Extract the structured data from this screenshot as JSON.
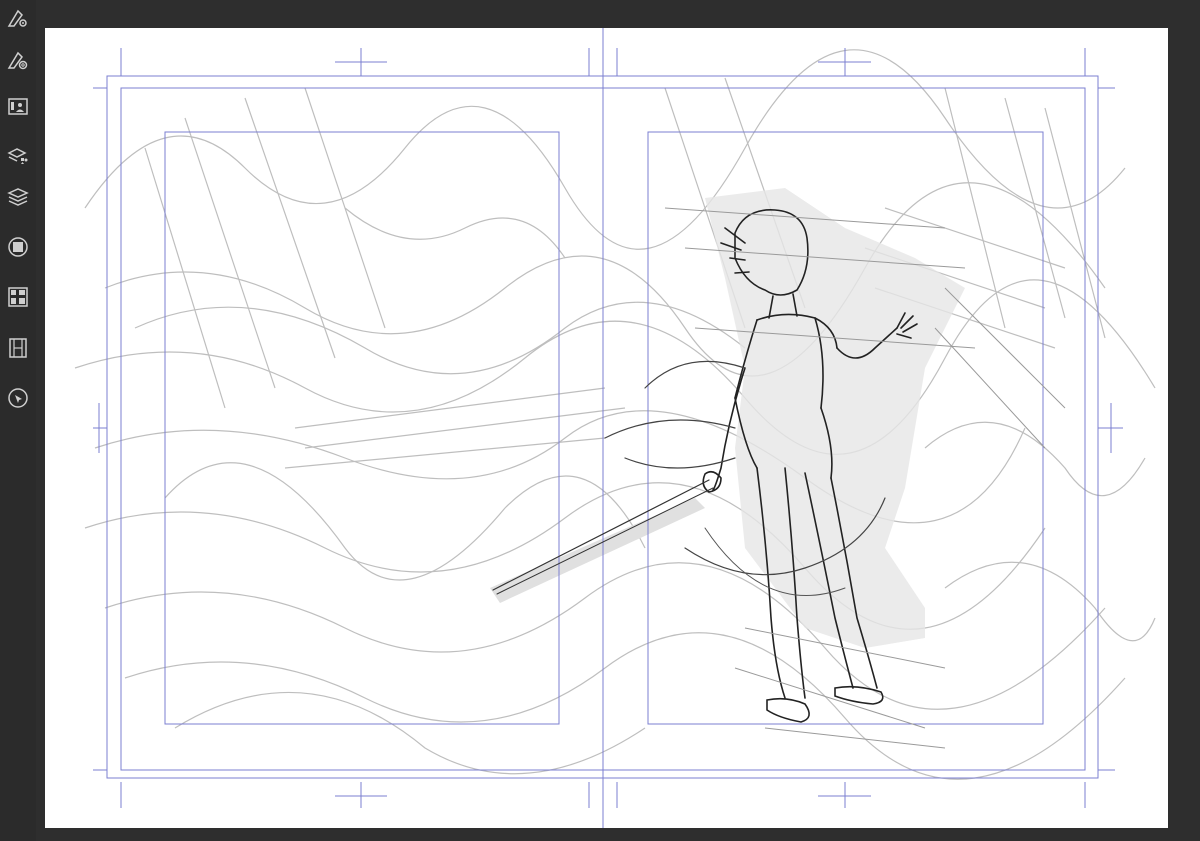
{
  "app": {
    "accent": "#7b7fd1",
    "toolbar_bg": "#2b2b2b",
    "canvas_bg": "#ffffff"
  },
  "toolbar": {
    "items": [
      {
        "name": "pen-settings",
        "icon": "pen-gear-icon"
      },
      {
        "name": "pen-target",
        "icon": "pen-target-icon"
      },
      {
        "name": "material-library",
        "icon": "folder-person-icon"
      },
      {
        "name": "layer-properties",
        "icon": "layer-shapes-icon"
      },
      {
        "name": "layers",
        "icon": "layers-icon"
      },
      {
        "name": "color",
        "icon": "color-circle-icon"
      },
      {
        "name": "pages",
        "icon": "page-grid-icon"
      },
      {
        "name": "timeline",
        "icon": "film-strip-icon"
      },
      {
        "name": "navigator",
        "icon": "navigator-icon"
      }
    ]
  },
  "document": {
    "layout": "two-page spread",
    "pages": [
      {
        "name": "left-page",
        "content": "rough-sketch"
      },
      {
        "name": "right-page",
        "content": "character-sketch-with-sword"
      }
    ]
  }
}
